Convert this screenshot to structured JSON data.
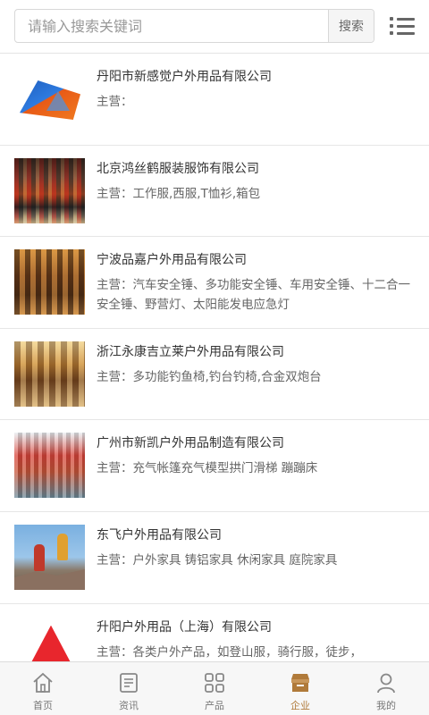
{
  "search": {
    "placeholder": "请输入搜索关键词",
    "button_label": "搜索"
  },
  "header": {
    "menu_icon": "list-menu-icon"
  },
  "companies": [
    {
      "name": "丹阳市新感觉户外用品有限公司",
      "desc": "主营：",
      "thumb": "tent"
    },
    {
      "name": "北京鸿丝鹤服装服饰有限公司",
      "desc": "主营：工作服,西服,T恤衫,箱包",
      "thumb": "store"
    },
    {
      "name": "宁波品嘉户外用品有限公司",
      "desc": "主营：汽车安全锤、多功能安全锤、车用安全锤、十二合一安全锤、野营灯、太阳能发电应急灯",
      "thumb": "store"
    },
    {
      "name": "浙江永康吉立莱户外用品有限公司",
      "desc": "主营：多功能钓鱼椅,钓台钓椅,合金双炮台",
      "thumb": "store"
    },
    {
      "name": "广州市新凯户外用品制造有限公司",
      "desc": "主营：充气帐篷充气模型拱门滑梯 蹦蹦床",
      "thumb": "store"
    },
    {
      "name": "东飞户外用品有限公司",
      "desc": "主营：户外家具 铸铝家具 休闲家具 庭院家具",
      "thumb": "climbers"
    },
    {
      "name": "升阳户外用品（上海）有限公司",
      "desc": "主营：各类户外产品，如登山服，骑行服，徒步，",
      "thumb": "red-tent"
    }
  ],
  "tabs": [
    {
      "label": "首页",
      "icon": "home-icon",
      "active": false
    },
    {
      "label": "资讯",
      "icon": "news-icon",
      "active": false
    },
    {
      "label": "产品",
      "icon": "grid-icon",
      "active": false
    },
    {
      "label": "企业",
      "icon": "enterprise-icon",
      "active": true
    },
    {
      "label": "我的",
      "icon": "user-icon",
      "active": false
    }
  ],
  "colors": {
    "active_tab": "#b07a3a",
    "inactive_tab": "#777777"
  }
}
